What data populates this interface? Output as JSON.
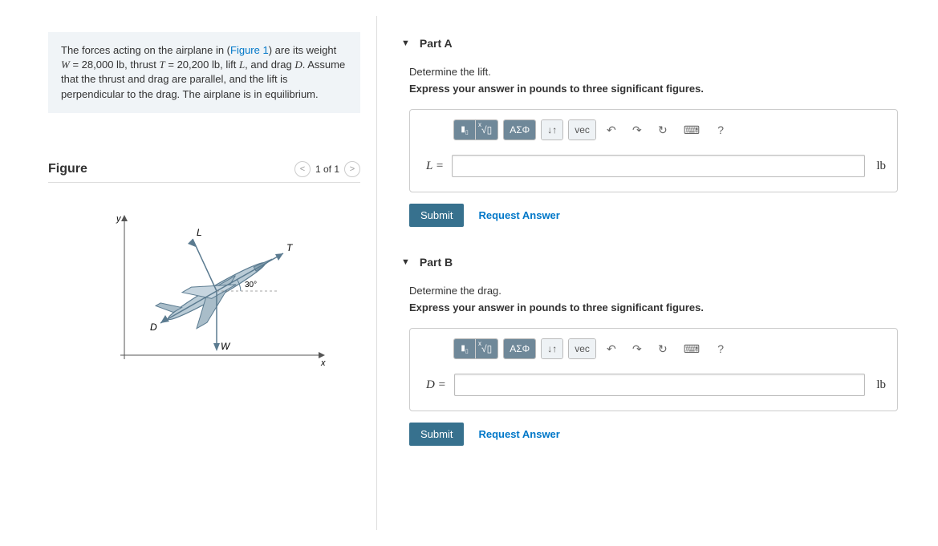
{
  "problem": {
    "text_pre": "The forces acting on the airplane in (",
    "fig_link": "Figure 1",
    "text_post1": ") are its weight ",
    "W": "W",
    "text_eqW": " = 28,000 ",
    "lb1": "lb",
    "text_thrust": ", thrust ",
    "T": "T",
    "text_eqT": " = 20,200 ",
    "lb2": "lb",
    "text_lift": ", lift ",
    "L": "L",
    "text_drag": ", and drag ",
    "D": "D",
    "text_end": ". Assume that the thrust and drag are parallel, and the lift is perpendicular to the drag. The airplane is in equilibrium."
  },
  "figure": {
    "title": "Figure",
    "pager": "1 of 1",
    "angle": "30°",
    "labels": {
      "y": "y",
      "x": "x",
      "L": "L",
      "T": "T",
      "D": "D",
      "W": "W"
    }
  },
  "parts": [
    {
      "name": "Part A",
      "prompt": "Determine the lift.",
      "instruction": "Express your answer in pounds to three significant figures.",
      "var": "L =",
      "unit": "lb",
      "submit": "Submit",
      "request": "Request Answer"
    },
    {
      "name": "Part B",
      "prompt": "Determine the drag.",
      "instruction": "Express your answer in pounds to three significant figures.",
      "var": "D =",
      "unit": "lb",
      "submit": "Submit",
      "request": "Request Answer"
    }
  ],
  "toolbar": {
    "templates": "▮",
    "sqrt": "√",
    "greek": "ΑΣΦ",
    "arrows": "↓↑",
    "vec": "vec",
    "undo": "↶",
    "redo": "↷",
    "reset": "↻",
    "keyboard": "⌨",
    "help": "?"
  }
}
